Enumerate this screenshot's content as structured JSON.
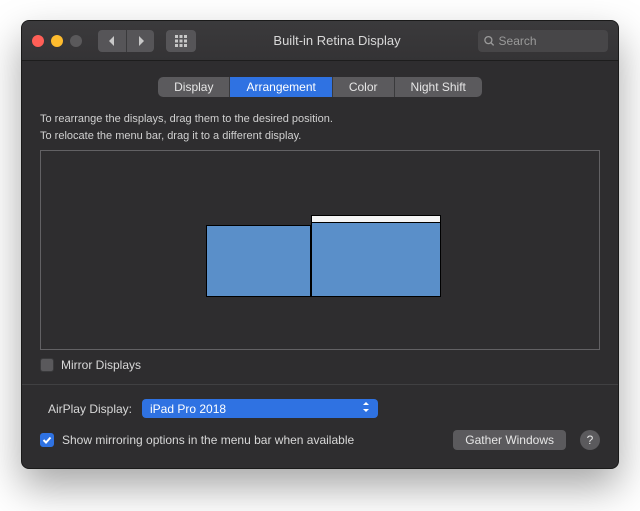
{
  "window": {
    "title": "Built-in Retina Display",
    "search_placeholder": "Search"
  },
  "tabs": {
    "display": "Display",
    "arrangement": "Arrangement",
    "color": "Color",
    "night_shift": "Night Shift",
    "active": "arrangement"
  },
  "instructions": {
    "line1": "To rearrange the displays, drag them to the desired position.",
    "line2": "To relocate the menu bar, drag it to a different display."
  },
  "mirror_displays_label": "Mirror Displays",
  "mirror_displays_checked": false,
  "airplay": {
    "label": "AirPlay Display:",
    "selected": "iPad Pro 2018"
  },
  "show_mirroring_label": "Show mirroring options in the menu bar when available",
  "show_mirroring_checked": true,
  "gather_windows_label": "Gather Windows",
  "help_label": "?"
}
